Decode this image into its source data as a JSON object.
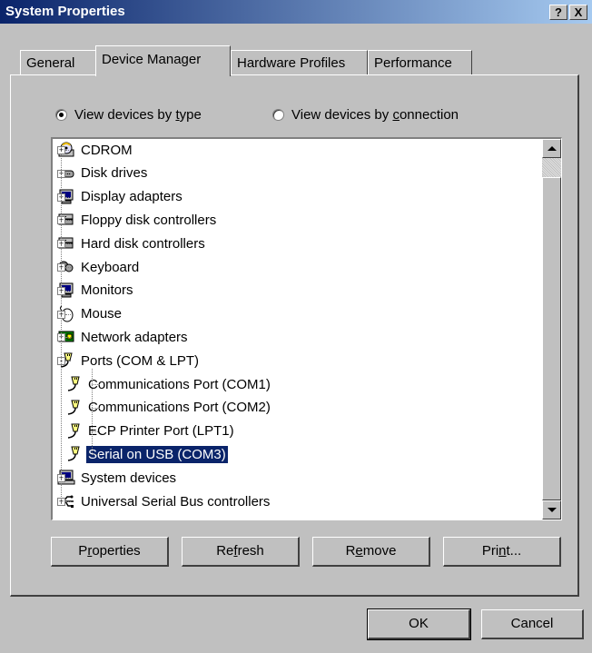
{
  "window": {
    "title": "System Properties",
    "help_glyph": "?",
    "close_glyph": "X"
  },
  "tabs": [
    {
      "label": "General",
      "active": false
    },
    {
      "label": "Device Manager",
      "active": true
    },
    {
      "label": "Hardware Profiles",
      "active": false
    },
    {
      "label": "Performance",
      "active": false
    }
  ],
  "view_options": {
    "by_type": {
      "pre": "View devices by ",
      "accel": "t",
      "post": "ype",
      "selected": true
    },
    "by_connection": {
      "pre": "View devices by ",
      "accel": "c",
      "post": "onnection",
      "selected": false
    }
  },
  "tree": {
    "items": [
      {
        "label": "CDROM",
        "icon": "cdrom-icon",
        "expander": "+"
      },
      {
        "label": "Disk drives",
        "icon": "disk-drive-icon",
        "expander": "+"
      },
      {
        "label": "Display adapters",
        "icon": "monitor-icon",
        "expander": "+"
      },
      {
        "label": "Floppy disk controllers",
        "icon": "controller-icon",
        "expander": "+"
      },
      {
        "label": "Hard disk controllers",
        "icon": "controller-icon",
        "expander": "+"
      },
      {
        "label": "Keyboard",
        "icon": "keyboard-icon",
        "expander": "+"
      },
      {
        "label": "Monitors",
        "icon": "monitor-icon",
        "expander": "+"
      },
      {
        "label": "Mouse",
        "icon": "mouse-icon",
        "expander": "+"
      },
      {
        "label": "Network adapters",
        "icon": "network-card-icon",
        "expander": "+"
      },
      {
        "label": "Ports (COM & LPT)",
        "icon": "port-icon",
        "expander": "-"
      },
      {
        "label": "Communications Port (COM1)",
        "icon": "port-icon",
        "child": true
      },
      {
        "label": "Communications Port (COM2)",
        "icon": "port-icon",
        "child": true
      },
      {
        "label": "ECP Printer Port (LPT1)",
        "icon": "port-icon",
        "child": true
      },
      {
        "label": "Serial on USB (COM3)",
        "icon": "port-icon",
        "child": true,
        "selected": true
      },
      {
        "label": "System devices",
        "icon": "computer-icon",
        "expander": "+"
      },
      {
        "label": "Universal Serial Bus controllers",
        "icon": "usb-icon",
        "expander": "+"
      }
    ]
  },
  "action_buttons": {
    "properties": {
      "pre": "P",
      "accel": "r",
      "post": "operties"
    },
    "refresh": {
      "pre": "Re",
      "accel": "f",
      "post": "resh"
    },
    "remove": {
      "pre": "R",
      "accel": "e",
      "post": "move"
    },
    "print": {
      "pre": "Pri",
      "accel": "n",
      "post": "t..."
    }
  },
  "dialog_buttons": {
    "ok": "OK",
    "cancel": "Cancel"
  },
  "colors": {
    "face": "#c0c0c0",
    "title_start": "#0a246a",
    "title_end": "#a6caf0",
    "selection": "#0a246a"
  }
}
